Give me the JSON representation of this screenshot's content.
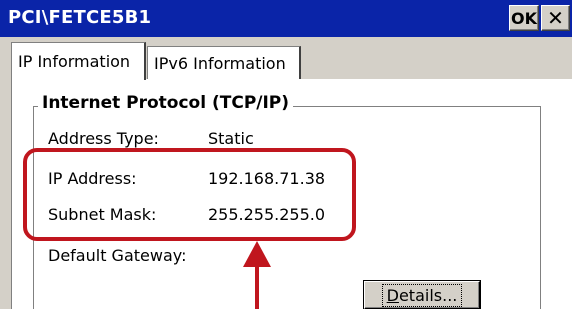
{
  "window": {
    "title": "PCI\\FETCE5B1",
    "ok_label": "OK",
    "close_label": "✕"
  },
  "tabs": [
    {
      "label": "IP Information",
      "active": true
    },
    {
      "label": "IPv6 Information",
      "active": false
    }
  ],
  "group": {
    "title": "Internet Protocol (TCP/IP)",
    "rows": [
      {
        "label": "Address Type:",
        "value": "Static"
      },
      {
        "label": "IP Address:",
        "value": "192.168.71.38"
      },
      {
        "label": "Subnet Mask:",
        "value": "255.255.255.0"
      },
      {
        "label": "Default Gateway:",
        "value": ""
      }
    ]
  },
  "details_button": {
    "prefix": "",
    "accel": "D",
    "rest": "etails..."
  },
  "annotation": {
    "color": "#c0161e",
    "arrow_icon": "arrow-up-icon"
  },
  "colors": {
    "titlebar": "#0a24a8",
    "dialog": "#d4d0c8"
  }
}
